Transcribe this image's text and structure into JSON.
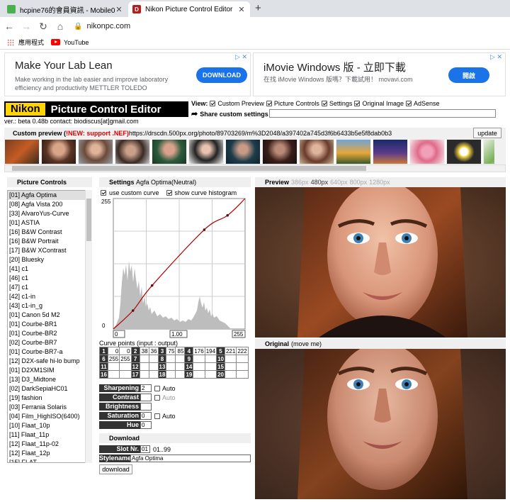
{
  "browser": {
    "tabs": [
      {
        "title": "hcpine76的會員資訊 - Mobile01",
        "fav": ""
      },
      {
        "title": "Nikon Picture Control Editor",
        "fav": "D"
      }
    ],
    "url": "nikonpc.com",
    "bookmarks": [
      "應用程式",
      "YouTube"
    ]
  },
  "ads": [
    {
      "headline": "Make Your Lab Lean",
      "text1": "Make working in the lab easier and improve laboratory",
      "text2": "efficiency and productivity METTLER TOLEDO",
      "button": "DOWNLOAD"
    },
    {
      "headline": "iMovie Windows 版 - 立即下載",
      "text1": "在找 iMovie Windows 版嗎？下載試用！ movavi.com",
      "button": "開啟"
    }
  ],
  "header": {
    "logo_left": "Nikon",
    "logo_right": "Picture Control Editor",
    "view_label": "View:",
    "view_options": [
      "Custom Preview",
      "Picture Controls",
      "Settings",
      "Original Image",
      "AdSense"
    ],
    "share_label": "Share custom settings",
    "version": "ver.: beta 0.48b contact: biodiscus[at]gmail.com"
  },
  "custom_preview": {
    "label": "Custom preview (",
    "new": "!NEW: support .NEF)",
    "url": " https://drscdn.500px.org/photo/89703269/m%3D2048/a397402a745d3f6b6433b5e5f8dab0b3",
    "update": "update"
  },
  "picture_controls": {
    "title": "Picture Controls",
    "items": [
      "[01] Agfa Optima",
      "[08] Agfa Vista 200",
      "[33] AlvaroYus-Curve",
      "[01] ASTIA",
      "[16] B&W Contrast",
      "[16] B&W Portrait",
      "[17] B&W XContrast",
      "[20] Bluesky",
      "[41] c1",
      "[46] c1",
      "[47] c1",
      "[42] c1-in",
      "[43] c1-in_g",
      "[01] Canon 5d M2",
      "[01] Courbe-BR1",
      "[01] Courbe-BR2",
      "[02] Courbe-BR7",
      "[01] Courbe-BR7-a",
      "[12] D2X-safe hi-lo bump",
      "[01] D2XM1SIM",
      "[13] D3_Midtone",
      "[02] DarkSepiaHC01",
      "[19] fashion",
      "[03] Ferrania Solaris",
      "[04] Film_HighISO(6400)",
      "[10] Flaat_10p",
      "[11] Flaat_11p",
      "[12] Flaat_11p-02",
      "[12] Flaat_12p",
      "[15] FLAT"
    ]
  },
  "settings": {
    "title": "Settings",
    "preset": "Agfa Optima(Neutral)",
    "use_curve": "use custom curve",
    "show_hist": "show curve histogram",
    "curve_top": "255",
    "curve_bottom": "0",
    "in_min": "0",
    "gamma": "1.00",
    "in_max": "255",
    "curve_points_label": "Curve points (input : output)",
    "points": [
      {
        "n": "1",
        "a": "0",
        "b": "0"
      },
      {
        "n": "2",
        "a": "38",
        "b": "36"
      },
      {
        "n": "3",
        "a": "75",
        "b": "85"
      },
      {
        "n": "4",
        "a": "176",
        "b": "194"
      },
      {
        "n": "5",
        "a": "221",
        "b": "222"
      },
      {
        "n": "6",
        "a": "255",
        "b": "255"
      },
      {
        "n": "7",
        "a": "",
        "b": ""
      },
      {
        "n": "8",
        "a": "",
        "b": ""
      },
      {
        "n": "9",
        "a": "",
        "b": ""
      },
      {
        "n": "10",
        "a": "",
        "b": ""
      },
      {
        "n": "11",
        "a": "",
        "b": ""
      },
      {
        "n": "12",
        "a": "",
        "b": ""
      },
      {
        "n": "13",
        "a": "",
        "b": ""
      },
      {
        "n": "14",
        "a": "",
        "b": ""
      },
      {
        "n": "15",
        "a": "",
        "b": ""
      },
      {
        "n": "16",
        "a": "",
        "b": ""
      },
      {
        "n": "17",
        "a": "",
        "b": ""
      },
      {
        "n": "18",
        "a": "",
        "b": ""
      },
      {
        "n": "19",
        "a": "",
        "b": ""
      },
      {
        "n": "20",
        "a": "",
        "b": ""
      }
    ],
    "sharpening": "Sharpening",
    "sharpening_val": "2",
    "contrast": "Contrast",
    "contrast_val": "",
    "brightness": "Brightness",
    "brightness_val": "",
    "saturation": "Saturation",
    "saturation_val": "0",
    "hue": "Hue",
    "hue_val": "0",
    "auto": "Auto"
  },
  "download": {
    "title": "Download",
    "slot_label": "Slot Nr.",
    "slot_val": "01",
    "slot_range": "01..99",
    "style_label": "Stylename",
    "style_val": "Agfa Optima",
    "button": "download"
  },
  "preview": {
    "title": "Preview",
    "sizes": [
      "386px",
      "480px",
      "640px",
      "800px",
      "1280px"
    ],
    "active_size": "480px",
    "original_title": "Original",
    "original_hint": "(move me)"
  },
  "colors": {
    "accent": "#ffd400",
    "ad_button": "#1a73e8",
    "curve": "#b00000"
  }
}
